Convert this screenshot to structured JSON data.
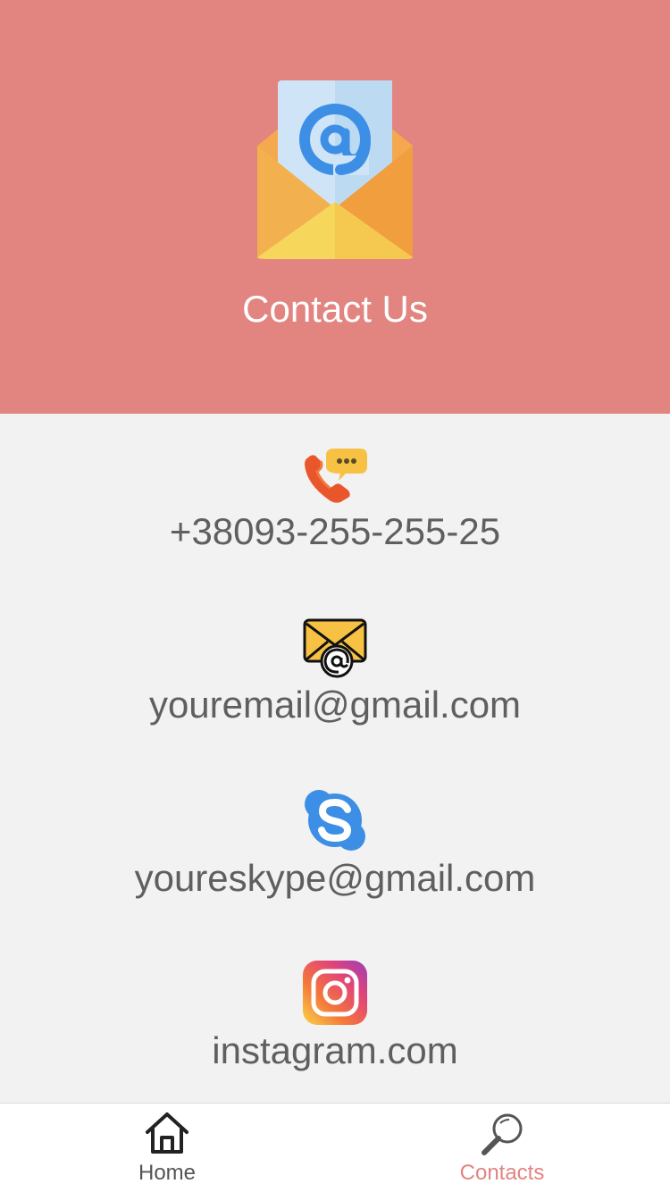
{
  "header": {
    "title": "Contact Us",
    "icon": "envelope-at-icon",
    "background": "#e28480"
  },
  "contacts": [
    {
      "icon": "phone-chat-icon",
      "text": "+38093-255-255-25"
    },
    {
      "icon": "email-at-icon",
      "text": "youremail@gmail.com"
    },
    {
      "icon": "skype-icon",
      "text": "youreskype@gmail.com"
    },
    {
      "icon": "instagram-icon",
      "text": "instagram.com"
    }
  ],
  "tabbar": {
    "tabs": [
      {
        "label": "Home",
        "icon": "home-icon",
        "active": false
      },
      {
        "label": "Contacts",
        "icon": "search-icon",
        "active": true
      }
    ],
    "active_color": "#e28480",
    "inactive_color": "#555555"
  }
}
